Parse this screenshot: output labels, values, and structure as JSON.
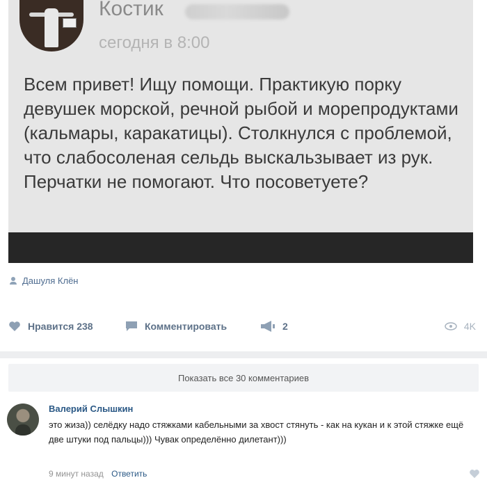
{
  "post": {
    "author_name": "Костик",
    "time": "сегодня в 8:00",
    "text": "Всем привет! Ищу помощи. Практикую порку девушек морской, речной рыбой и морепродуктами (кальмары, каракатицы). Столкнулся с проблемой, что слабосоленая сельдь выскальзывает из рук. Перчатки не помогают. Что посоветуете?"
  },
  "attribution": {
    "name": "Дашуля Клён",
    "icon": "person-icon"
  },
  "actions": {
    "like_label": "Нравится",
    "like_count": "238",
    "comment_label": "Комментировать",
    "share_count": "2",
    "views": "4K"
  },
  "show_all_comments": "Показать все 30 комментариев",
  "comment": {
    "author": "Валерий Слышкин",
    "text": "это жиза)) селёдку надо стяжками кабельными за хвост стянуть - как на кукан и к этой стяжке ещё две штуки под пальцы))) Чувак определённо дилетант)))",
    "time": "9 минут назад",
    "reply_label": "Ответить"
  },
  "colors": {
    "link": "#2a5885",
    "action": "#5d7188",
    "post_bg": "#e6e6e6"
  }
}
